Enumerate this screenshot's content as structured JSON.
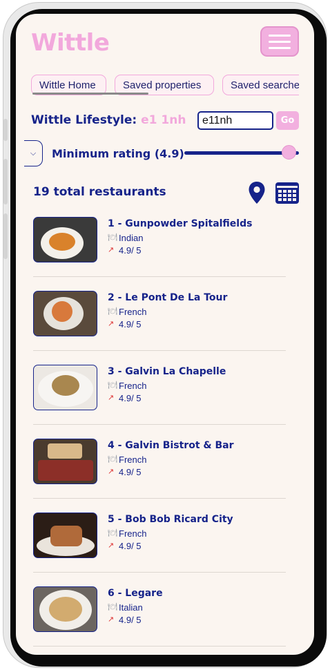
{
  "app": {
    "logo": "Wittle"
  },
  "tabs": [
    {
      "label": "Wittle Home"
    },
    {
      "label": "Saved properties"
    },
    {
      "label": "Saved searches"
    }
  ],
  "lifestyle": {
    "label": "Wittle Lifestyle:",
    "postcode": "e1 1nh",
    "input_value": "e11nh",
    "go_label": "Go"
  },
  "filter": {
    "label": "Minimum rating (4.9)",
    "slider_value": 4.9
  },
  "results": {
    "total_label": "19 total restaurants"
  },
  "restaurants": [
    {
      "title": "1 - Gunpowder Spitalfields",
      "cuisine": "Indian",
      "rating": "4.9/ 5"
    },
    {
      "title": "2 - Le Pont De La Tour",
      "cuisine": "French",
      "rating": "4.9/ 5"
    },
    {
      "title": "3 - Galvin La Chapelle",
      "cuisine": "French",
      "rating": "4.9/ 5"
    },
    {
      "title": "4 - Galvin Bistrot & Bar",
      "cuisine": "French",
      "rating": "4.9/ 5"
    },
    {
      "title": "5 - Bob Bob Ricard City",
      "cuisine": "French",
      "rating": "4.9/ 5"
    },
    {
      "title": "6 - Legare",
      "cuisine": "Italian",
      "rating": "4.9/ 5"
    }
  ],
  "colors": {
    "brand_pink": "#f2a8dc",
    "navy": "#16238a",
    "background": "#fbf5f0"
  }
}
